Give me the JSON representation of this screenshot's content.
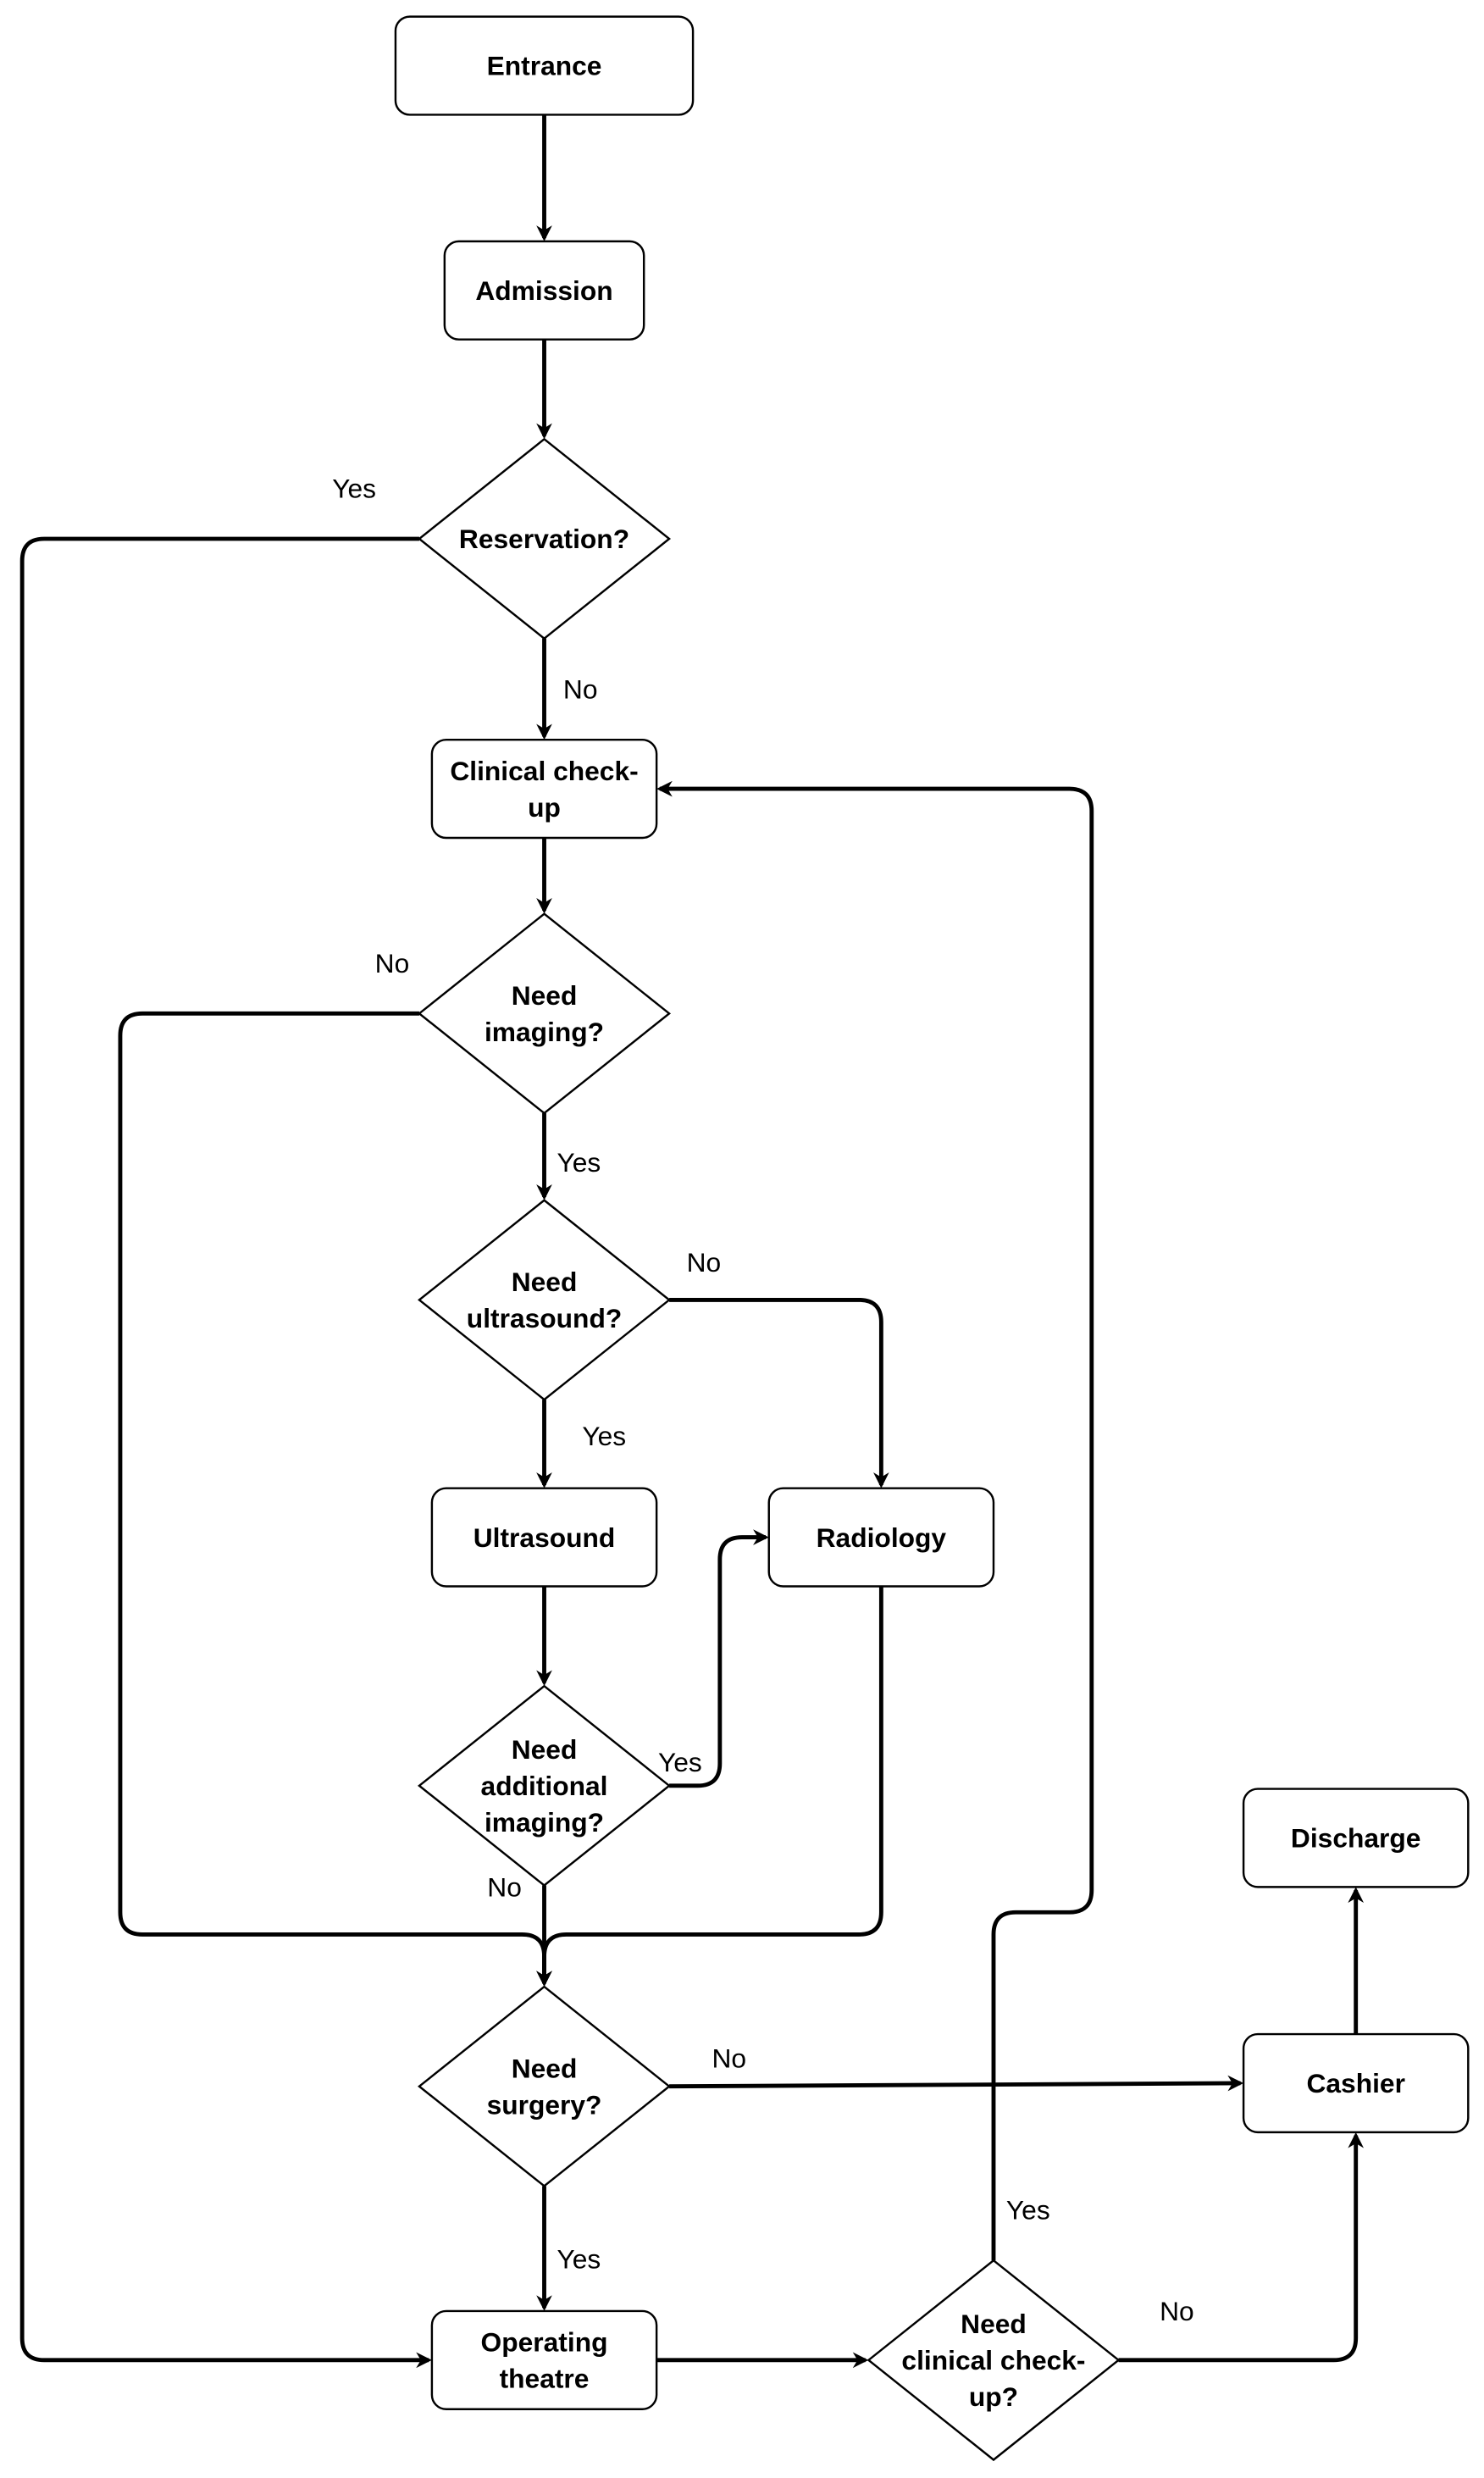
{
  "diagram": {
    "type": "flowchart",
    "nodes": {
      "entrance": {
        "label": [
          "Entrance"
        ],
        "shape": "process"
      },
      "admission": {
        "label": [
          "Admission"
        ],
        "shape": "process"
      },
      "reservation": {
        "label": [
          "Reservation?"
        ],
        "shape": "decision"
      },
      "clinical_checkup": {
        "label": [
          "Clinical check-",
          "up"
        ],
        "shape": "process"
      },
      "need_imaging": {
        "label": [
          "Need",
          "imaging?"
        ],
        "shape": "decision"
      },
      "need_ultrasound": {
        "label": [
          "Need",
          "ultrasound?"
        ],
        "shape": "decision"
      },
      "ultrasound": {
        "label": [
          "Ultrasound"
        ],
        "shape": "process"
      },
      "radiology": {
        "label": [
          "Radiology"
        ],
        "shape": "process"
      },
      "need_additional_imaging": {
        "label": [
          "Need",
          "additional",
          "imaging?"
        ],
        "shape": "decision"
      },
      "need_surgery": {
        "label": [
          "Need",
          "surgery?"
        ],
        "shape": "decision"
      },
      "operating_theatre": {
        "label": [
          "Operating",
          "theatre"
        ],
        "shape": "process"
      },
      "need_clinical_checkup": {
        "label": [
          "Need",
          "clinical check-",
          "up?"
        ],
        "shape": "decision"
      },
      "cashier": {
        "label": [
          "Cashier"
        ],
        "shape": "process"
      },
      "discharge": {
        "label": [
          "Discharge"
        ],
        "shape": "process"
      }
    },
    "edges": [
      {
        "from": "entrance",
        "to": "admission",
        "label": ""
      },
      {
        "from": "admission",
        "to": "reservation",
        "label": ""
      },
      {
        "from": "reservation",
        "to": "operating_theatre",
        "label": "Yes"
      },
      {
        "from": "reservation",
        "to": "clinical_checkup",
        "label": "No"
      },
      {
        "from": "clinical_checkup",
        "to": "need_imaging",
        "label": ""
      },
      {
        "from": "need_imaging",
        "to": "need_surgery",
        "label": "No"
      },
      {
        "from": "need_imaging",
        "to": "need_ultrasound",
        "label": "Yes"
      },
      {
        "from": "need_ultrasound",
        "to": "radiology",
        "label": "No"
      },
      {
        "from": "need_ultrasound",
        "to": "ultrasound",
        "label": "Yes"
      },
      {
        "from": "ultrasound",
        "to": "need_additional_imaging",
        "label": ""
      },
      {
        "from": "need_additional_imaging",
        "to": "radiology",
        "label": "Yes"
      },
      {
        "from": "need_additional_imaging",
        "to": "need_surgery",
        "label": "No"
      },
      {
        "from": "radiology",
        "to": "need_surgery",
        "label": ""
      },
      {
        "from": "need_surgery",
        "to": "cashier",
        "label": "No"
      },
      {
        "from": "need_surgery",
        "to": "operating_theatre",
        "label": "Yes"
      },
      {
        "from": "operating_theatre",
        "to": "need_clinical_checkup",
        "label": ""
      },
      {
        "from": "need_clinical_checkup",
        "to": "clinical_checkup",
        "label": "Yes"
      },
      {
        "from": "need_clinical_checkup",
        "to": "cashier",
        "label": "No"
      },
      {
        "from": "cashier",
        "to": "discharge",
        "label": ""
      }
    ]
  }
}
